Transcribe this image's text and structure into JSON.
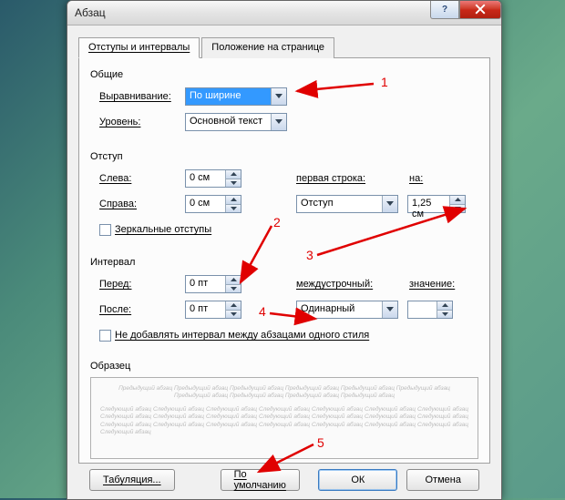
{
  "window": {
    "title": "Абзац"
  },
  "tabs": {
    "indents": "Отступы и интервалы",
    "position": "Положение на странице"
  },
  "general": {
    "section": "Общие",
    "alignment_label": "Выравнивание:",
    "alignment_value": "По ширине",
    "level_label": "Уровень:",
    "level_value": "Основной текст"
  },
  "indent": {
    "section": "Отступ",
    "left_label": "Слева:",
    "left_value": "0 см",
    "right_label": "Справа:",
    "right_value": "0 см",
    "first_line_label": "первая строка:",
    "first_line_value": "Отступ",
    "by_label": "на:",
    "by_value": "1,25 см",
    "mirror_label": "Зеркальные отступы"
  },
  "spacing": {
    "section": "Интервал",
    "before_label": "Перед:",
    "before_value": "0 пт",
    "after_label": "После:",
    "after_value": "0 пт",
    "line_label": "междустрочный:",
    "line_value": "Одинарный",
    "at_label": "значение:",
    "at_value": "",
    "no_space_label": "Не добавлять интервал между абзацами одного стиля"
  },
  "preview": {
    "section": "Образец",
    "text_before": "Предыдущий абзац Предыдущий абзац Предыдущий абзац Предыдущий абзац Предыдущий абзац Предыдущий абзац Предыдущий абзац Предыдущий абзац Предыдущий абзац Предыдущий абзац",
    "text_after": "Следующий абзац Следующий абзац Следующий абзац Следующий абзац Следующий абзац Следующий абзац Следующий абзац Следующий абзац Следующий абзац Следующий абзац Следующий абзац Следующий абзац Следующий абзац Следующий абзац Следующий абзац Следующий абзац Следующий абзац Следующий абзац Следующий абзац Следующий абзац Следующий абзац Следующий абзац"
  },
  "buttons": {
    "tabs": "Табуляция...",
    "default": "По умолчанию",
    "ok": "ОК",
    "cancel": "Отмена"
  },
  "annotations": {
    "n1": "1",
    "n2": "2",
    "n3": "3",
    "n4": "4",
    "n5": "5"
  }
}
